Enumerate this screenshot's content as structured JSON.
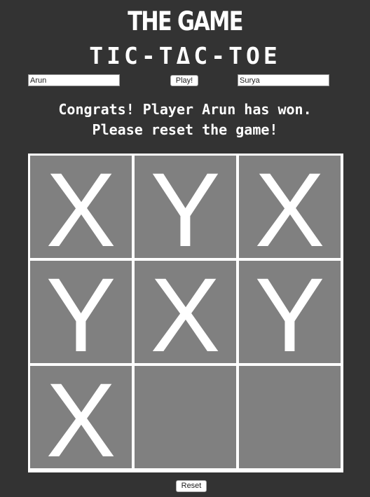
{
  "header": {
    "title": "THE GAME",
    "subtitle": "TIC-TΔC-TOE"
  },
  "players": {
    "player1_value": "Arun",
    "player2_value": "Surya",
    "play_label": "Play!"
  },
  "status": {
    "line1": "Congrats! Player Arun has won.",
    "line2": "Please reset the game!"
  },
  "board": {
    "cells": [
      "X",
      "Y",
      "X",
      "Y",
      "X",
      "Y",
      "X",
      "",
      ""
    ]
  },
  "controls": {
    "reset_label": "Reset"
  },
  "colors": {
    "background": "#333333",
    "cell": "#808080",
    "grid_lines": "#ffffff",
    "text": "#ffffff"
  }
}
